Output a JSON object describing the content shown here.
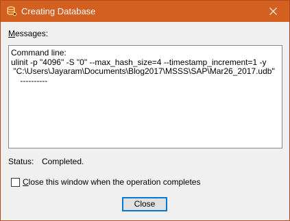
{
  "window": {
    "title": "Creating Database",
    "title_bar_color": "#d35f21",
    "app_icon": "database-gear-icon",
    "close_icon": "close-icon"
  },
  "messages": {
    "label_accel": "M",
    "label_rest": "essages:",
    "lines": [
      "Command line:",
      "ulinit -p \"4096\" -S \"0\" --max_hash_size=4 --timestamp_increment=1 -y",
      " \"C:\\Users\\Jayaram\\Documents\\Blog2017\\MSSS\\SAP\\Mar26_2017.udb\"",
      "    ----------"
    ]
  },
  "status": {
    "label": "Status:",
    "value": "Completed."
  },
  "close_when_done": {
    "checked": false,
    "label_accel": "C",
    "label_rest": "lose this window when the operation completes"
  },
  "buttons": {
    "close_label": "Close"
  }
}
